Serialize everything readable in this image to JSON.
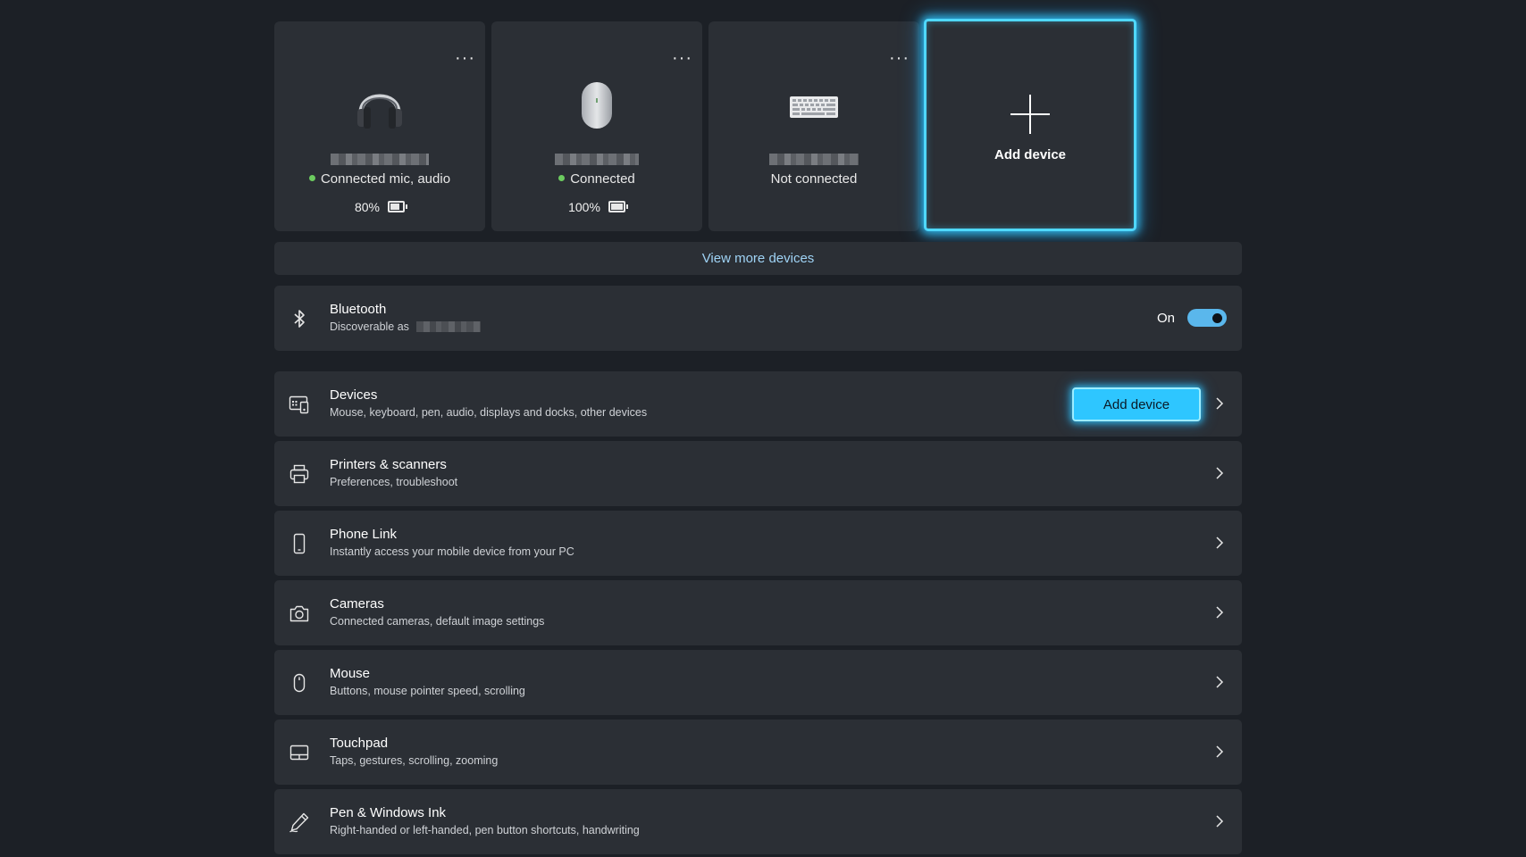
{
  "device_cards": [
    {
      "icon": "headphones-icon",
      "status": "Connected mic, audio",
      "connected": true,
      "battery_text": "80%",
      "battery_level": 0.8
    },
    {
      "icon": "mouse-icon",
      "status": "Connected",
      "connected": true,
      "battery_text": "100%",
      "battery_level": 1.0
    },
    {
      "icon": "keyboard-icon",
      "status": "Not connected",
      "connected": false
    }
  ],
  "more_menu_glyph": "···",
  "add_card": {
    "icon": "plus-icon",
    "label": "Add device"
  },
  "view_more": "View more devices",
  "bluetooth": {
    "icon": "bluetooth-icon",
    "title": "Bluetooth",
    "subtitle": "Discoverable as",
    "toggle_label": "On",
    "enabled": true
  },
  "settings_rows": [
    {
      "key": "devices",
      "icon": "devices-icon",
      "title": "Devices",
      "subtitle": "Mouse, keyboard, pen, audio, displays and docks, other devices",
      "button": "Add device"
    },
    {
      "key": "printers",
      "icon": "printer-icon",
      "title": "Printers & scanners",
      "subtitle": "Preferences, troubleshoot"
    },
    {
      "key": "phone-link",
      "icon": "phone-icon",
      "title": "Phone Link",
      "subtitle": "Instantly access your mobile device from your PC"
    },
    {
      "key": "cameras",
      "icon": "camera-icon",
      "title": "Cameras",
      "subtitle": "Connected cameras, default image settings"
    },
    {
      "key": "mouse",
      "icon": "mouse-icon",
      "title": "Mouse",
      "subtitle": "Buttons, mouse pointer speed, scrolling"
    },
    {
      "key": "touchpad",
      "icon": "touchpad-icon",
      "title": "Touchpad",
      "subtitle": "Taps, gestures, scrolling, zooming"
    },
    {
      "key": "pen",
      "icon": "pen-icon",
      "title": "Pen & Windows Ink",
      "subtitle": "Right-handed or left-handed, pen button shortcuts, handwriting"
    }
  ],
  "colors": {
    "background": "#1c2026",
    "card": "#2b2f35",
    "accent": "#4fd8ff",
    "toggle_on": "#5ab7ec",
    "link": "#9fd3f5",
    "connected_dot": "#6ccb5f"
  }
}
